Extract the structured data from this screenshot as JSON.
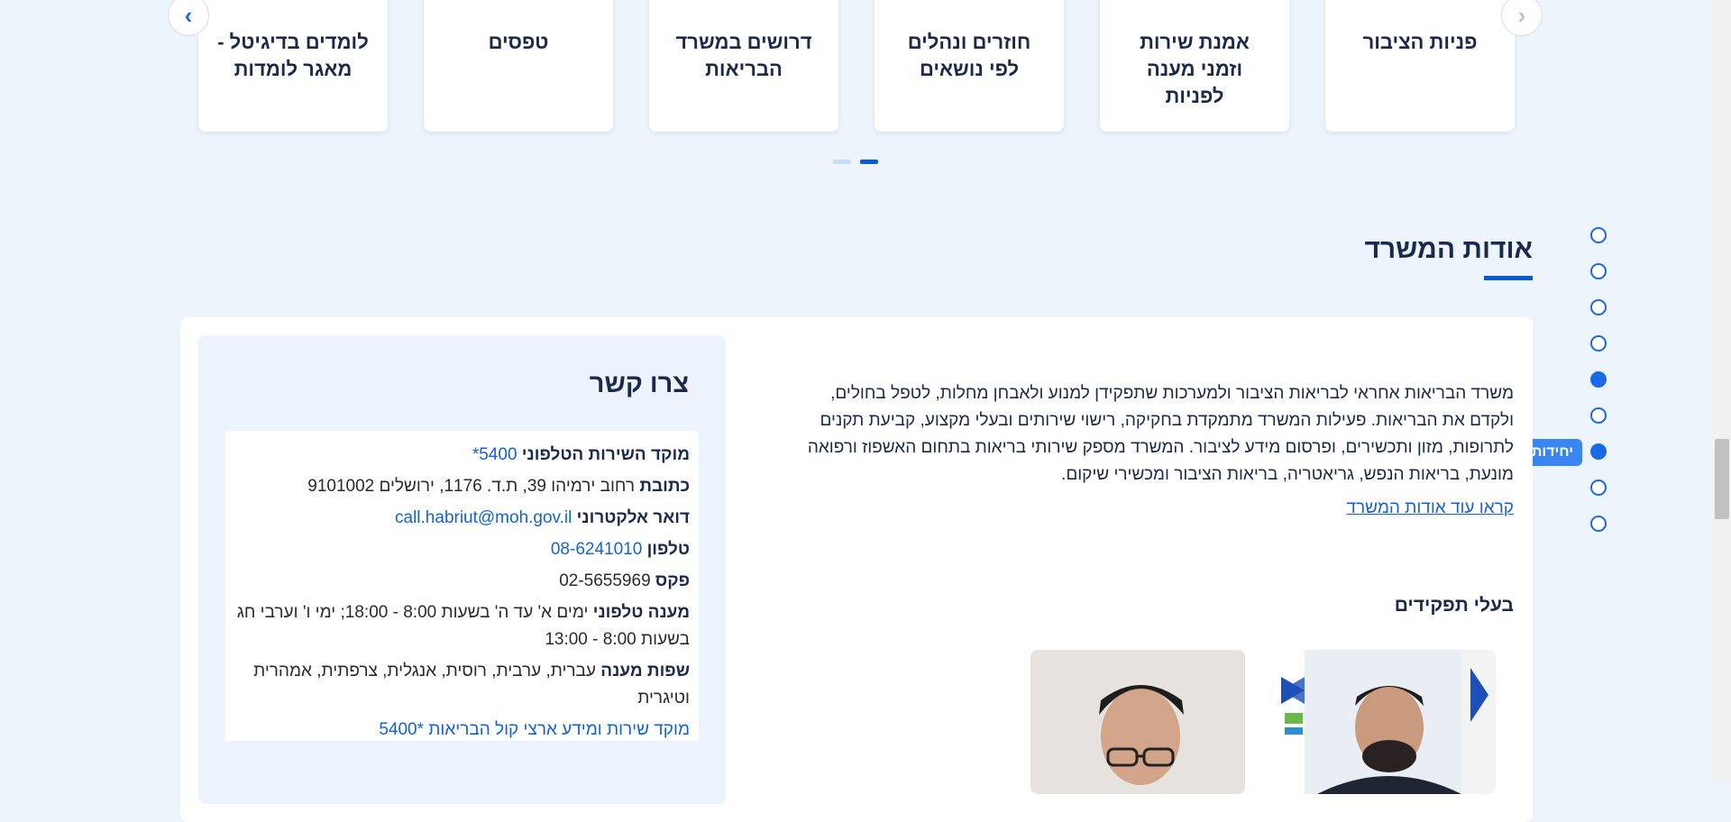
{
  "carousel": {
    "cards": [
      {
        "title": "פניות הציבור"
      },
      {
        "title": "אמנת שירות וזמני מענה לפניות"
      },
      {
        "title": "חוזרים ונהלים לפי נושאים"
      },
      {
        "title": "דרושים במשרד הבריאות"
      },
      {
        "title": "טפסים"
      },
      {
        "title": "לומדים בדיגיטל - מאגר לומדות"
      }
    ],
    "prev_icon": "‹",
    "next_icon": "›",
    "pages": 2,
    "active_page": 2
  },
  "about": {
    "title": "אודות המשרד",
    "text": "משרד הבריאות אחראי לבריאות הציבור ולמערכות שתפקידן למנוע ולאבחן מחלות, לטפל בחולים, ולקדם את הבריאות. פעילות המשרד מתמקדת בחקיקה, רישוי שירותים ובעלי מקצוע, קביעת תקנים לתרופות, מזון ותכשירים, ופרסום מידע לציבור. המשרד מספק שירותי בריאות בתחום האשפוז ורפואה מונעת, בריאות הנפש, גריאטריה, בריאות הציבור ומכשירי שיקום.",
    "read_more": "קראו עוד אודות המשרד",
    "roles_title": "בעלי תפקידים"
  },
  "side_nav": {
    "tooltip": "יחידות",
    "dot_count": 9,
    "filled_dots": [
      5,
      7
    ]
  },
  "contact": {
    "title": "צרו קשר",
    "call_center_label": "מוקד השירות הטלפוני",
    "call_center_value": "*5400",
    "address_label": "כתובת",
    "address_value": "רחוב ירמיהו 39, ת.ד. 1176, ירושלים 9101002",
    "email_label": "דואר אלקטרוני",
    "email_value": "call.habriut@moh.gov.il",
    "phone_label": "טלפון",
    "phone_value": "08-6241010",
    "fax_label": "פקס",
    "fax_value": "02-5655969",
    "hours_label": "מענה טלפוני",
    "hours_value": "ימים א' עד ה' בשעות 8:00 - 18:00; ימי ו' וערבי חג בשעות 8:00 - 13:00",
    "languages_label": "שפות מענה",
    "languages_value": "עברית, ערבית, רוסית, אנגלית, צרפתית, אמהרית וטיגרית",
    "kol_habriut_link": "מוקד שירות ומידע ארצי קול הבריאות *5400"
  },
  "colors": {
    "accent": "#0a5ad4",
    "link": "#1462d6",
    "page_bg": "#eef4fc",
    "heading": "#1b2a4a"
  }
}
